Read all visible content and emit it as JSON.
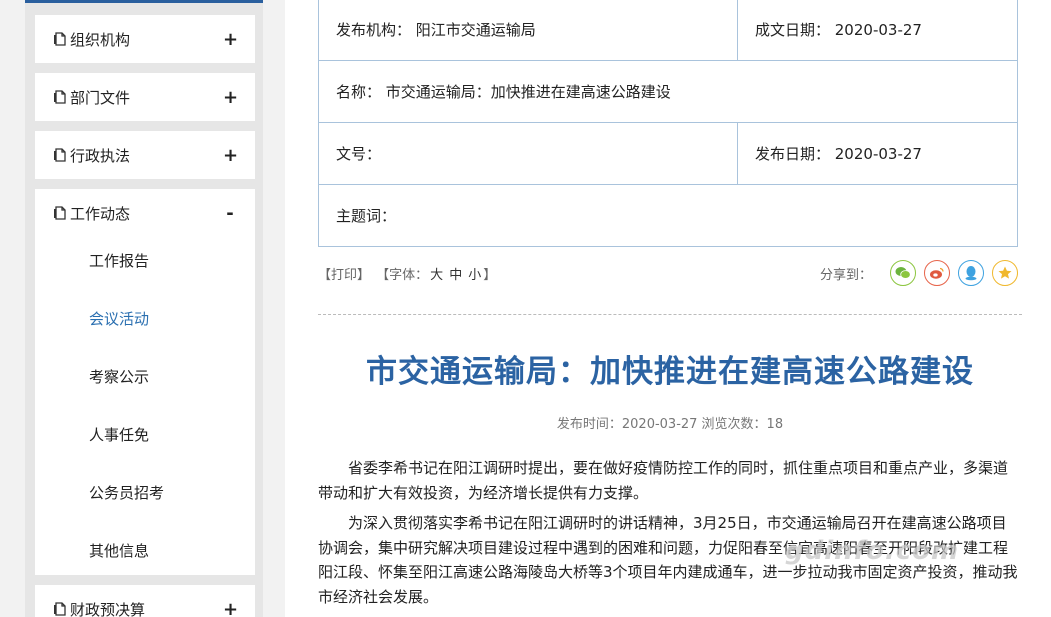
{
  "sidebar": {
    "sections": [
      {
        "label": "组织机构",
        "toggle": "+"
      },
      {
        "label": "部门文件",
        "toggle": "+"
      },
      {
        "label": "行政执法",
        "toggle": "+"
      },
      {
        "label": "工作动态",
        "toggle": "-"
      },
      {
        "label": "财政预决算",
        "toggle": "+"
      }
    ],
    "work_items": [
      "工作报告",
      "会议活动",
      "考察公示",
      "人事任免",
      "公务员招考",
      "其他信息"
    ],
    "active_item": "会议活动",
    "accent_color": "#2a6fb0"
  },
  "info_table": {
    "publisher": "发布机构： 阳江市交通运输局",
    "created_date": "成文日期： 2020-03-27",
    "name": "名称： 市交通运输局：加快推进在建高速公路建设",
    "doc_no": "文号：",
    "publish_date": "发布日期： 2020-03-27",
    "keywords": "主题词："
  },
  "toolbar": {
    "print": "【打印】",
    "font_prefix": "【字体：",
    "font_large": "大",
    "font_medium": "中",
    "font_small": "小",
    "font_suffix": "】",
    "share_label": "分享到：",
    "share_icons": [
      "wechat-icon",
      "weibo-icon",
      "qq-icon",
      "qzone-icon"
    ]
  },
  "article": {
    "title": "市交通运输局：加快推进在建高速公路建设",
    "meta": "发布时间：2020-03-27  浏览次数：18",
    "paragraphs": [
      "省委李希书记在阳江调研时提出，要在做好疫情防控工作的同时，抓住重点项目和重点产业，多渠道带动和扩大有效投资，为经济增长提供有力支撑。",
      "为深入贯彻落实李希书记在阳江调研时的讲话精神，3月25日，市交通运输局召开在建高速公路项目协调会，集中研究解决项目建设过程中遇到的困难和问题，力促阳春至信宜高速阳春至开阳段改扩建工程阳江段、怀集至阳江高速公路海陵岛大桥等3个项目年内建成通车，进一步拉动我市固定资产投资，推动我市经济社会发展。"
    ]
  },
  "watermark": "gdinfo.com"
}
